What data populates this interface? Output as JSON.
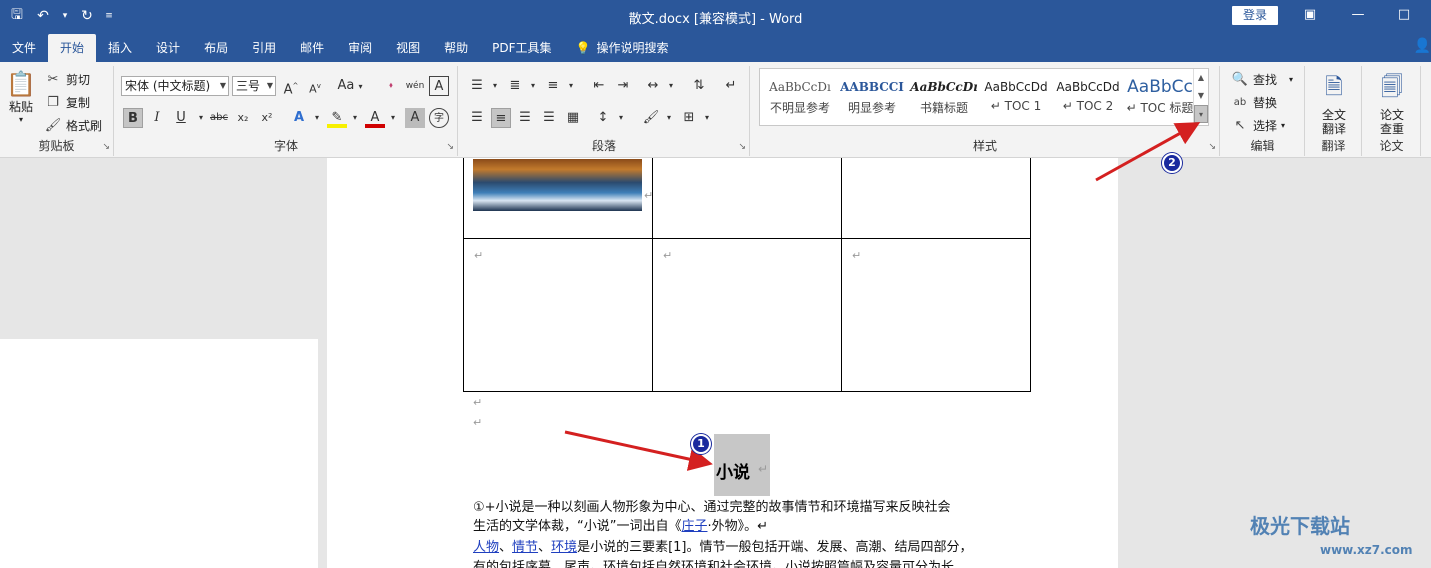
{
  "title_bar": {
    "doc_title": "散文.docx [兼容模式] - Word",
    "login": "登录"
  },
  "tabs": [
    "文件",
    "开始",
    "插入",
    "设计",
    "布局",
    "引用",
    "邮件",
    "审阅",
    "视图",
    "帮助",
    "PDF工具集"
  ],
  "tell_me": "操作说明搜索",
  "clipboard": {
    "paste": "粘贴",
    "cut": "剪切",
    "copy": "复制",
    "format_painter": "格式刷",
    "label": "剪贴板"
  },
  "font": {
    "name": "宋体 (中文标题)",
    "size": "三号",
    "label": "字体",
    "bold": "B",
    "italic": "I",
    "underline": "U",
    "strike": "abc",
    "sub": "x₂",
    "sup": "x²",
    "grow": "A",
    "shrink": "A",
    "case": "Aa",
    "phonetic": "wén",
    "char_border": "A",
    "font_color_letter": "A",
    "shade_letter": "A",
    "enclose": "字"
  },
  "paragraph": {
    "label": "段落"
  },
  "styles": {
    "label": "样式",
    "items": [
      {
        "preview": "AaBbCcDı",
        "name": "不明显参考"
      },
      {
        "preview": "AABBCCI",
        "name": "明显参考"
      },
      {
        "preview": "AaBbCcDı",
        "name": "书籍标题"
      },
      {
        "preview": "AaBbCcDd",
        "name": "↵ TOC 1"
      },
      {
        "preview": "AaBbCcDd",
        "name": "↵ TOC 2"
      },
      {
        "preview": "AaBbCc",
        "name": "↵ TOC 标题"
      }
    ]
  },
  "editing": {
    "find": "查找",
    "replace": "替换",
    "select": "选择",
    "label": "编辑"
  },
  "translate": {
    "button": "全文翻译",
    "label": "翻译"
  },
  "paper": {
    "button": "论文查重",
    "label": "论文"
  },
  "document": {
    "paragraph_mark": "↵",
    "heading": "小说",
    "line1": "①+小说是一种以刻画人物形象为中心、通过完整的故事情节和环境描写来反映社会",
    "line2_before": "生活的文学体裁，“小说”一词出自《",
    "line2_link": "庄子",
    "line2_after": "·外物》。↵",
    "line3_link1": "人物",
    "line3_sep1": "、",
    "line3_link2": "情节",
    "line3_sep2": "、",
    "line3_link3": "环境",
    "line3_after": "是小说的三要素[1]。情节一般包括开端、发展、高潮、结局四部分，",
    "line4": "有的包括序幕、尾声。环境包括自然环境和社会环境。小说按照篇幅及容量可分为长"
  },
  "badges": {
    "one": "1",
    "two": "2"
  },
  "watermark": {
    "name": "极光下载站",
    "url": "www.xz7.com"
  },
  "colors": {
    "brand": "#2b579a",
    "arrow": "#d42020",
    "badge": "#1a2a9e"
  }
}
